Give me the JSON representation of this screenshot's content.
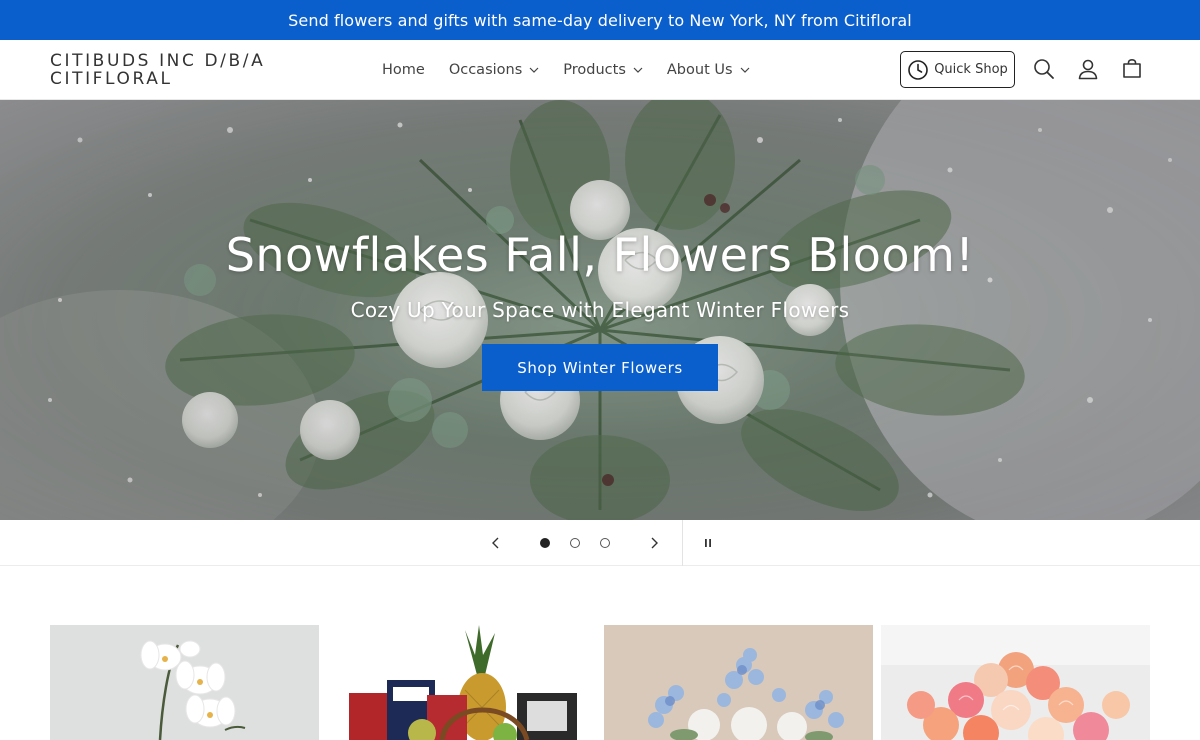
{
  "announcement": "Send flowers and gifts with same-day delivery to New York, NY from Citifloral",
  "logo": {
    "line1": "CITIBUDS INC D/B/A",
    "line2": "CITIFLORAL"
  },
  "nav": [
    {
      "label": "Home",
      "has_dropdown": false
    },
    {
      "label": "Occasions",
      "has_dropdown": true
    },
    {
      "label": "Products",
      "has_dropdown": true
    },
    {
      "label": "About Us",
      "has_dropdown": true
    }
  ],
  "header": {
    "quick_shop_label": "Quick Shop",
    "icons": [
      "clock-icon",
      "search-icon",
      "account-icon",
      "cart-icon"
    ]
  },
  "hero": {
    "title": "Snowflakes Fall, Flowers Bloom!",
    "subtitle": "Cozy Up Your Space with Elegant Winter Flowers",
    "cta_label": "Shop Winter Flowers",
    "slide_count": 3,
    "active_slide": 1
  },
  "slider_icons": [
    "chevron-left-icon",
    "chevron-right-icon",
    "pause-icon"
  ],
  "product_cards": [
    {
      "image": "white-orchid-plant"
    },
    {
      "image": "gourmet-fruit-basket"
    },
    {
      "image": "blue-white-floral-arrangement"
    },
    {
      "image": "pink-peach-rose-bouquet"
    }
  ],
  "colors": {
    "brand_blue": "#0a5fcc",
    "text_dark": "#222222"
  }
}
